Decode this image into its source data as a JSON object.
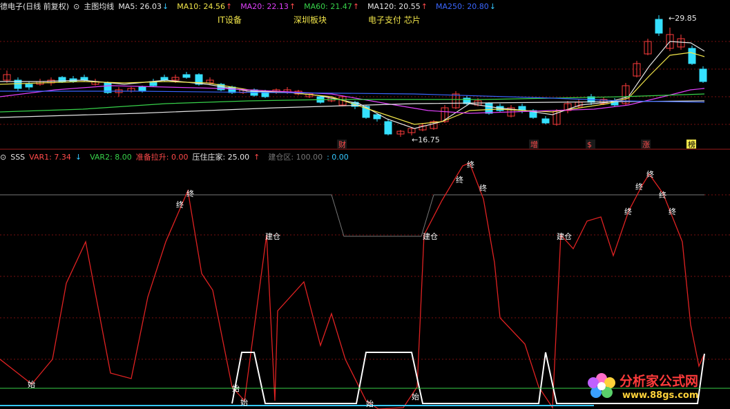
{
  "header": {
    "stock_title": "德电子(日线 前复权)",
    "indicator_name": "主图均线",
    "ma": [
      {
        "label": "MA5: 26.03",
        "arrow": "↓",
        "color": "#e6e6e6"
      },
      {
        "label": "MA10: 24.56",
        "arrow": "↑",
        "color": "#f2e64a"
      },
      {
        "label": "MA20: 22.13",
        "arrow": "↑",
        "color": "#e040fb"
      },
      {
        "label": "MA60: 21.47",
        "arrow": "↑",
        "color": "#37d24a"
      },
      {
        "label": "MA120: 20.55",
        "arrow": "↑",
        "color": "#e6e6e6"
      },
      {
        "label": "MA250: 20.80",
        "arrow": "↓",
        "color": "#3a66ff"
      }
    ]
  },
  "sectors": [
    "IT设备",
    "深圳板块",
    "电子支付 芯片"
  ],
  "price_annotations": {
    "high": "29.85",
    "low": "16.75"
  },
  "event_markers": [
    "财",
    "增",
    "$",
    "涨",
    "榜"
  ],
  "subchart_header": {
    "name": "SSS",
    "var1": "VAR1: 7.34",
    "var1_arrow": "↓",
    "var2": "VAR2: 8.00",
    "prep": "准备拉升: 0.00",
    "press": "压住庄家: 25.00",
    "press_arrow": "↑",
    "build": "建仓区: 100.00",
    "build_extra": ": 0.00"
  },
  "signal_labels": {
    "start": "始",
    "end": "终",
    "build": "建仓"
  },
  "watermark": {
    "line1": "分析家公式网",
    "line2": "www.88gs.com"
  },
  "colors": {
    "up": "#ff3b3b",
    "down": "#35e0ff",
    "grid": "#7a1010"
  }
}
